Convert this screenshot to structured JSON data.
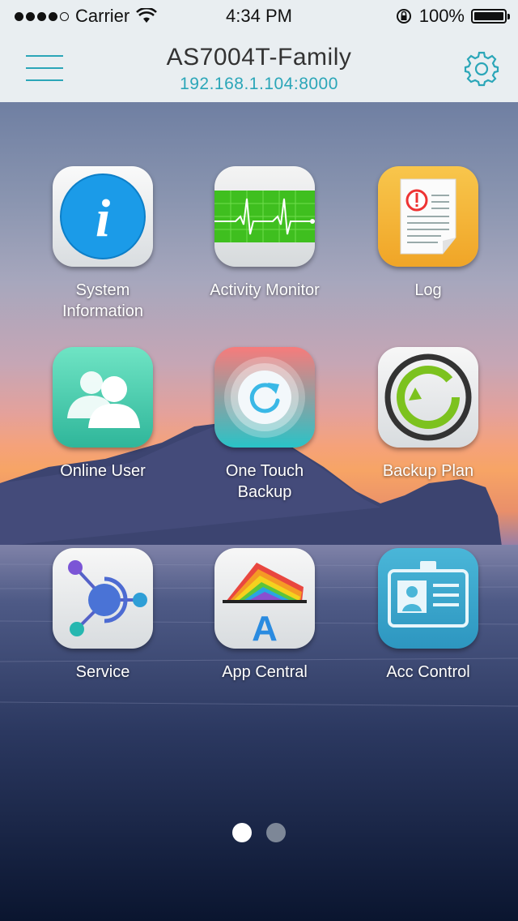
{
  "status_bar": {
    "carrier": "Carrier",
    "time": "4:34 PM",
    "battery": "100%",
    "battery_level": 1.0
  },
  "nav": {
    "title": "AS7004T-Family",
    "subtitle": "192.168.1.104:8000",
    "menu_icon": "hamburger-icon",
    "settings_icon": "gear-icon",
    "accent": "#2ba6b8"
  },
  "apps": [
    {
      "label": "System Information",
      "icon": "info-icon"
    },
    {
      "label": "Activity Monitor",
      "icon": "heartbeat-monitor-icon"
    },
    {
      "label": "Log",
      "icon": "log-document-icon"
    },
    {
      "label": "Online User",
      "icon": "users-icon"
    },
    {
      "label": "One Touch Backup",
      "icon": "one-touch-backup-icon"
    },
    {
      "label": "Backup Plan",
      "icon": "backup-plan-icon"
    },
    {
      "label": "Service",
      "icon": "service-nodes-icon"
    },
    {
      "label": "App Central",
      "icon": "app-central-icon"
    },
    {
      "label": "Acc Control",
      "icon": "id-card-icon"
    }
  ],
  "pager": {
    "pages": 2,
    "current": 1
  }
}
